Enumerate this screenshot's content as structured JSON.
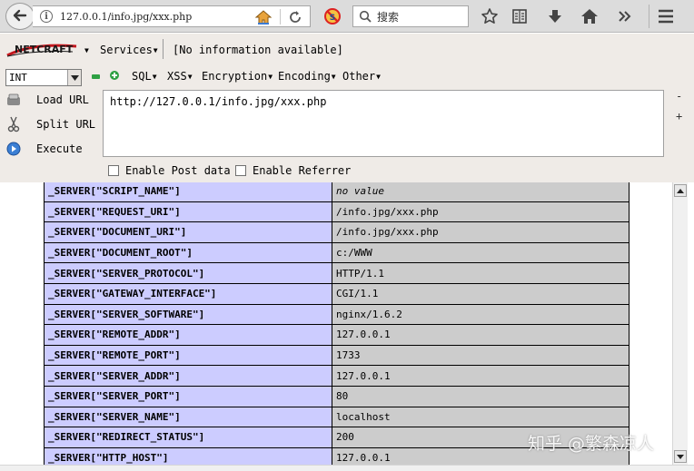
{
  "navbar": {
    "url": "127.0.0.1/info.jpg/xxx.php",
    "search_placeholder": "搜索",
    "icons": [
      "back-icon",
      "info-icon",
      "home-icon",
      "reload-icon",
      "noscript-icon",
      "search-icon",
      "star-icon",
      "reading-list-icon",
      "download-icon",
      "home-icon",
      "overflow-chevron-icon",
      "hamburger-menu-icon"
    ]
  },
  "hackbar": {
    "netcraft_logo": "NETCRAFT",
    "menu": {
      "services": "Services",
      "info": "[No information available]"
    },
    "select_value": "INT",
    "toolbar": {
      "sql": "SQL",
      "xss": "XSS",
      "encryption": "Encryption",
      "encoding": "Encoding",
      "other": "Other"
    },
    "actions": {
      "load_url": "Load URL",
      "split_url": "Split URL",
      "execute": "Execute"
    },
    "url_field": "http://127.0.0.1/info.jpg/xxx.php",
    "side_minus": "-",
    "side_plus": "+",
    "enable_post": "Enable Post data",
    "enable_referrer": "Enable Referrer",
    "colors": {
      "logo_red": "#c4161c",
      "green": "#2ea043"
    }
  },
  "server_table": {
    "rows": [
      {
        "key": "_SERVER[\"SCRIPT_NAME\"]",
        "value": "no value",
        "italic": true
      },
      {
        "key": "_SERVER[\"REQUEST_URI\"]",
        "value": "/info.jpg/xxx.php"
      },
      {
        "key": "_SERVER[\"DOCUMENT_URI\"]",
        "value": "/info.jpg/xxx.php"
      },
      {
        "key": "_SERVER[\"DOCUMENT_ROOT\"]",
        "value": "c:/WWW"
      },
      {
        "key": "_SERVER[\"SERVER_PROTOCOL\"]",
        "value": "HTTP/1.1"
      },
      {
        "key": "_SERVER[\"GATEWAY_INTERFACE\"]",
        "value": "CGI/1.1"
      },
      {
        "key": "_SERVER[\"SERVER_SOFTWARE\"]",
        "value": "nginx/1.6.2"
      },
      {
        "key": "_SERVER[\"REMOTE_ADDR\"]",
        "value": "127.0.0.1"
      },
      {
        "key": "_SERVER[\"REMOTE_PORT\"]",
        "value": "1733"
      },
      {
        "key": "_SERVER[\"SERVER_ADDR\"]",
        "value": "127.0.0.1"
      },
      {
        "key": "_SERVER[\"SERVER_PORT\"]",
        "value": "80"
      },
      {
        "key": "_SERVER[\"SERVER_NAME\"]",
        "value": "localhost"
      },
      {
        "key": "_SERVER[\"REDIRECT_STATUS\"]",
        "value": "200"
      },
      {
        "key": "_SERVER[\"HTTP_HOST\"]",
        "value": "127.0.0.1"
      }
    ],
    "colors": {
      "key_bg": "#ccccff",
      "value_bg": "#cccccc"
    }
  },
  "watermark": "知乎 @繁森凉人"
}
